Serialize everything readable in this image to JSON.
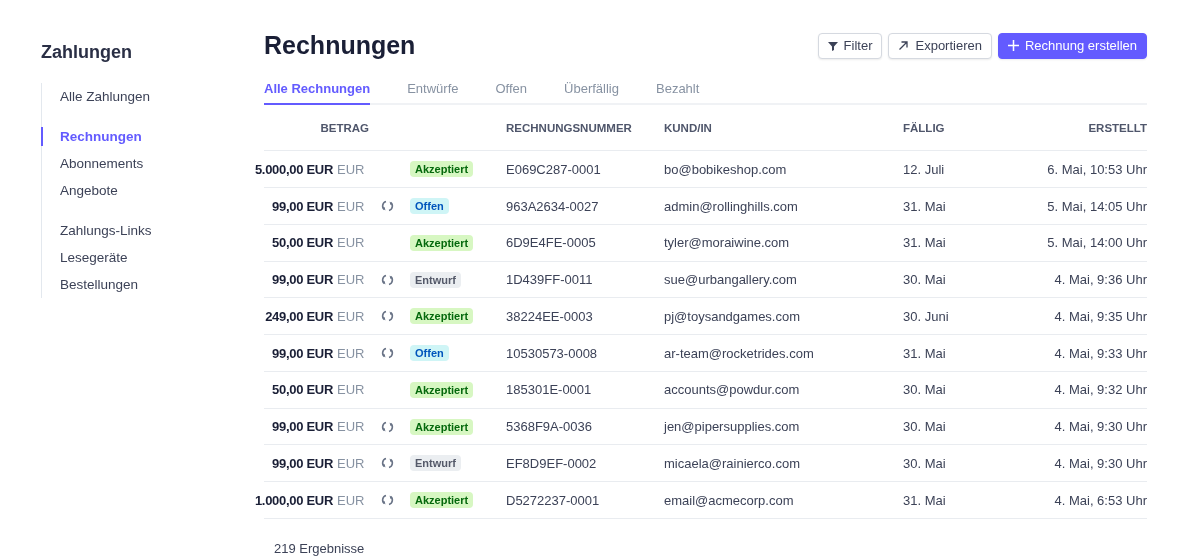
{
  "sidebar": {
    "title": "Zahlungen",
    "groups": [
      {
        "items": [
          {
            "label": "Alle Zahlungen",
            "selected": false
          }
        ]
      },
      {
        "items": [
          {
            "label": "Rechnungen",
            "selected": true
          },
          {
            "label": "Abonnements",
            "selected": false
          },
          {
            "label": "Angebote",
            "selected": false
          }
        ]
      },
      {
        "items": [
          {
            "label": "Zahlungs-Links",
            "selected": false
          },
          {
            "label": "Lesegeräte",
            "selected": false
          },
          {
            "label": "Bestellungen",
            "selected": false
          }
        ]
      }
    ]
  },
  "page": {
    "title": "Rechnungen",
    "actions": [
      {
        "kind": "filter",
        "label": "Filter"
      },
      {
        "kind": "export",
        "label": "Exportieren"
      },
      {
        "kind": "create",
        "label": "Rechnung erstellen"
      }
    ]
  },
  "tabs": [
    {
      "label": "Alle Rechnungen",
      "selected": true
    },
    {
      "label": "Entwürfe",
      "selected": false
    },
    {
      "label": "Offen",
      "selected": false
    },
    {
      "label": "Überfällig",
      "selected": false
    },
    {
      "label": "Bezahlt",
      "selected": false
    }
  ],
  "table": {
    "columns": [
      "BETRAG",
      "RECHNUNGSNUMMER",
      "KUND/IN",
      "FÄLLIG",
      "ERSTELLT"
    ],
    "rows": [
      {
        "amount": "5.000,00 EUR",
        "currency": "EUR",
        "recurring": false,
        "status": {
          "kind": "accepted",
          "label": "Akzeptiert"
        },
        "number": "E069C287-0001",
        "customer": "bo@bobikeshop.com",
        "due": "12. Juli",
        "created": "6. Mai, 10:53 Uhr"
      },
      {
        "amount": "99,00 EUR",
        "currency": "EUR",
        "recurring": true,
        "status": {
          "kind": "open",
          "label": "Offen"
        },
        "number": "963A2634-0027",
        "customer": "admin@rollinghills.com",
        "due": "31. Mai",
        "created": "5. Mai, 14:05 Uhr"
      },
      {
        "amount": "50,00 EUR",
        "currency": "EUR",
        "recurring": false,
        "status": {
          "kind": "accepted",
          "label": "Akzeptiert"
        },
        "number": "6D9E4FE-0005",
        "customer": "tyler@moraiwine.com",
        "due": "31. Mai",
        "created": "5. Mai, 14:00 Uhr"
      },
      {
        "amount": "99,00 EUR",
        "currency": "EUR",
        "recurring": true,
        "status": {
          "kind": "draft",
          "label": "Entwurf"
        },
        "number": "1D439FF-0011",
        "customer": "sue@urbangallery.com",
        "due": "30. Mai",
        "created": "4. Mai, 9:36 Uhr"
      },
      {
        "amount": "249,00 EUR",
        "currency": "EUR",
        "recurring": true,
        "status": {
          "kind": "accepted",
          "label": "Akzeptiert"
        },
        "number": "38224EE-0003",
        "customer": "pj@toysandgames.com",
        "due": "30. Juni",
        "created": "4. Mai, 9:35 Uhr"
      },
      {
        "amount": "99,00 EUR",
        "currency": "EUR",
        "recurring": true,
        "status": {
          "kind": "open",
          "label": "Offen"
        },
        "number": "10530573-0008",
        "customer": "ar-team@rocketrides.com",
        "due": "31. Mai",
        "created": "4. Mai, 9:33 Uhr"
      },
      {
        "amount": "50,00 EUR",
        "currency": "EUR",
        "recurring": false,
        "status": {
          "kind": "accepted",
          "label": "Akzeptiert"
        },
        "number": "185301E-0001",
        "customer": "accounts@powdur.com",
        "due": "30. Mai",
        "created": "4. Mai, 9:32 Uhr"
      },
      {
        "amount": "99,00 EUR",
        "currency": "EUR",
        "recurring": true,
        "status": {
          "kind": "accepted",
          "label": "Akzeptiert"
        },
        "number": "5368F9A-0036",
        "customer": "jen@pipersupplies.com",
        "due": "30. Mai",
        "created": "4. Mai, 9:30 Uhr"
      },
      {
        "amount": "99,00 EUR",
        "currency": "EUR",
        "recurring": true,
        "status": {
          "kind": "draft",
          "label": "Entwurf"
        },
        "number": "EF8D9EF-0002",
        "customer": "micaela@rainierco.com",
        "due": "30. Mai",
        "created": "4. Mai, 9:30 Uhr"
      },
      {
        "amount": "1.000,00 EUR",
        "currency": "EUR",
        "recurring": true,
        "status": {
          "kind": "accepted",
          "label": "Akzeptiert"
        },
        "number": "D5272237-0001",
        "customer": "email@acmecorp.com",
        "due": "31. Mai",
        "created": "4. Mai, 6:53 Uhr"
      }
    ]
  },
  "footer": {
    "results": "219 Ergebnisse"
  }
}
